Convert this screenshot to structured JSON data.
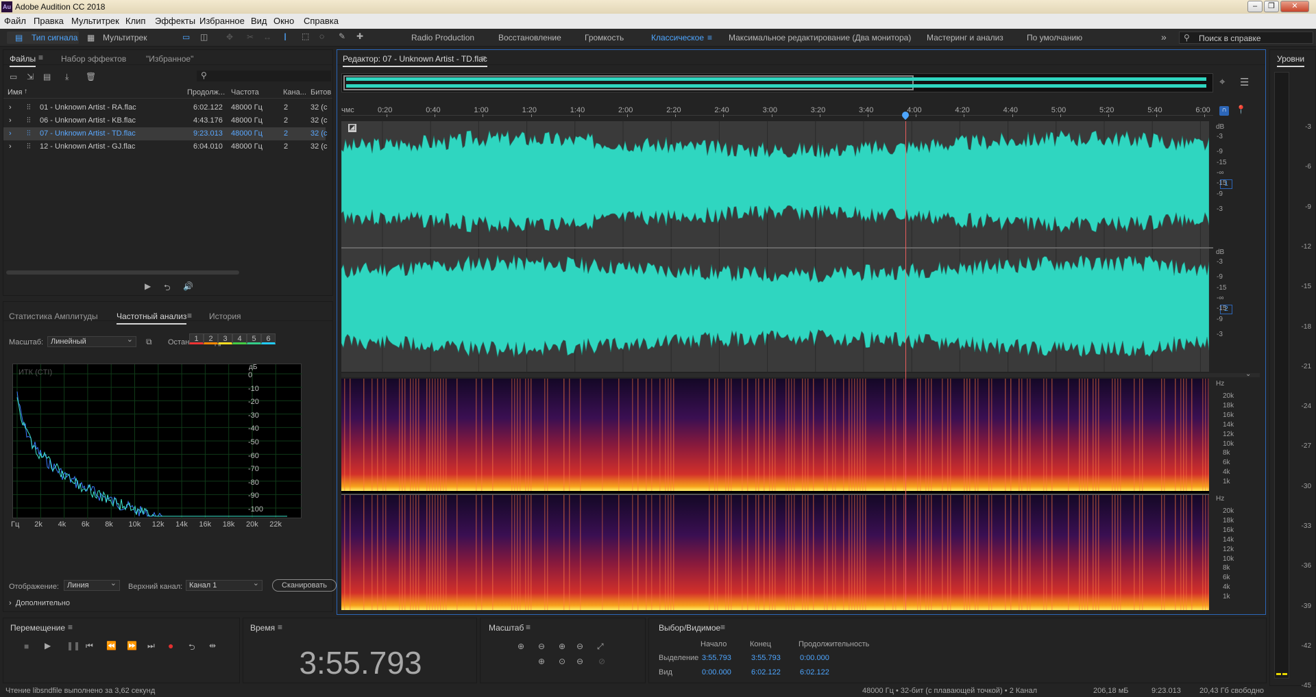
{
  "app": {
    "title": "Adobe Audition CC 2018",
    "logo": "Au"
  },
  "window_buttons": [
    "–",
    "❐",
    "✕"
  ],
  "menu": [
    "Файл",
    "Правка",
    "Мультитрек",
    "Клип",
    "Эффекты",
    "Избранное",
    "Вид",
    "Окно",
    "Справка"
  ],
  "toolbar": {
    "waveform_label": "Тип сигнала",
    "multitrack_label": "Мультитрек",
    "workspaces": [
      "Radio Production",
      "Восстановление",
      "Громкость",
      "Классическое",
      "Максимальное редактирование (Два монитора)",
      "Мастеринг и анализ",
      "По умолчанию"
    ],
    "active_workspace": "Классическое",
    "help_search_placeholder": "Поиск в справке"
  },
  "files_panel": {
    "tabs": [
      "Файлы",
      "Набор эффектов",
      "\"Избранное\""
    ],
    "columns": [
      "Имя",
      "Продолж...",
      "Частота",
      "Кана...",
      "Битов"
    ],
    "rows": [
      {
        "name": "01 - Unknown Artist - RA.flac",
        "dur": "6:02.122",
        "rate": "48000 Гц",
        "ch": "2",
        "bits": "32 (с"
      },
      {
        "name": "06 - Unknown Artist - KB.flac",
        "dur": "4:43.176",
        "rate": "48000 Гц",
        "ch": "2",
        "bits": "32 (с"
      },
      {
        "name": "07 - Unknown Artist - TD.flac",
        "dur": "9:23.013",
        "rate": "48000 Гц",
        "ch": "2",
        "bits": "32 (с"
      },
      {
        "name": "12 - Unknown Artist - GJ.flac",
        "dur": "6:04.010",
        "rate": "48000 Гц",
        "ch": "2",
        "bits": "32 (с"
      }
    ],
    "selected_index": 2
  },
  "freq_panel": {
    "tabs": [
      "Статистика Амплитуды",
      "Частотный анализ",
      "История"
    ],
    "scale_label": "Масштаб:",
    "scale_value": "Линейный",
    "freeze_label": "Остановка кадра:",
    "freeze_buttons": [
      "1",
      "2",
      "3",
      "4",
      "5",
      "6"
    ],
    "freeze_colors": [
      "#e33",
      "#f80",
      "#fd2",
      "#4c4",
      "#3c8",
      "#2cf"
    ],
    "graph_label": "ИТК (CTI)",
    "y_unit": "дБ",
    "y_ticks": [
      "0",
      "-10",
      "-20",
      "-30",
      "-40",
      "-50",
      "-60",
      "-70",
      "-80",
      "-90",
      "-100"
    ],
    "x_ticks": [
      "Гц",
      "2k",
      "4k",
      "6k",
      "8k",
      "10k",
      "12k",
      "14k",
      "16k",
      "18k",
      "20k",
      "22k"
    ],
    "display_label": "Отображение:",
    "display_value": "Линия",
    "channel_label": "Верхний канал:",
    "channel_value": "Канал 1",
    "scan_button": "Сканировать",
    "advanced": "Дополнительно"
  },
  "editor": {
    "title": "Редактор: 07 - Unknown Artist - TD.flac",
    "ruler_unit": "чмс",
    "ruler_ticks": [
      "0:20",
      "0:40",
      "1:00",
      "1:20",
      "1:40",
      "2:00",
      "2:20",
      "2:40",
      "3:00",
      "3:20",
      "3:40",
      "4:00",
      "4:20",
      "4:40",
      "5:00",
      "5:20",
      "5:40",
      "6:00"
    ],
    "db_unit": "dB",
    "db_labels": [
      "-3",
      "-9",
      "-15",
      "-∞",
      "-15",
      "-9",
      "-3"
    ],
    "channels": [
      "1",
      "2"
    ],
    "hz_unit": "Hz",
    "hz_labels": [
      "20k",
      "18k",
      "16k",
      "14k",
      "12k",
      "10k",
      "8k",
      "6k",
      "4k",
      "1k"
    ],
    "wave_color": "#2fd6c0"
  },
  "levels": {
    "title": "Уровни",
    "ticks": [
      "-3",
      "-6",
      "-9",
      "-12",
      "-15",
      "-18",
      "-21",
      "-24",
      "-27",
      "-30",
      "-33",
      "-36",
      "-39",
      "-42",
      "-45"
    ]
  },
  "transport": {
    "title": "Перемещение"
  },
  "time_panel": {
    "title": "Время",
    "value": "3:55.793"
  },
  "zoom_panel": {
    "title": "Масштаб"
  },
  "selection_panel": {
    "title": "Выбор/Видимое",
    "headers": [
      "Начало",
      "Конец",
      "Продолжительность"
    ],
    "rows": [
      {
        "label": "Выделение",
        "start": "3:55.793",
        "end": "3:55.793",
        "dur": "0:00.000"
      },
      {
        "label": "Вид",
        "start": "0:00.000",
        "end": "6:02.122",
        "dur": "6:02.122"
      }
    ]
  },
  "status": {
    "left": "Чтение libsndfile выполнено за 3,62 секунд",
    "format": "48000 Гц • 32-бит (с плавающей точкой) • 2 Канал",
    "size": "206,18 мБ",
    "duration": "9:23.013",
    "free": "20,43 Гб свободно"
  }
}
